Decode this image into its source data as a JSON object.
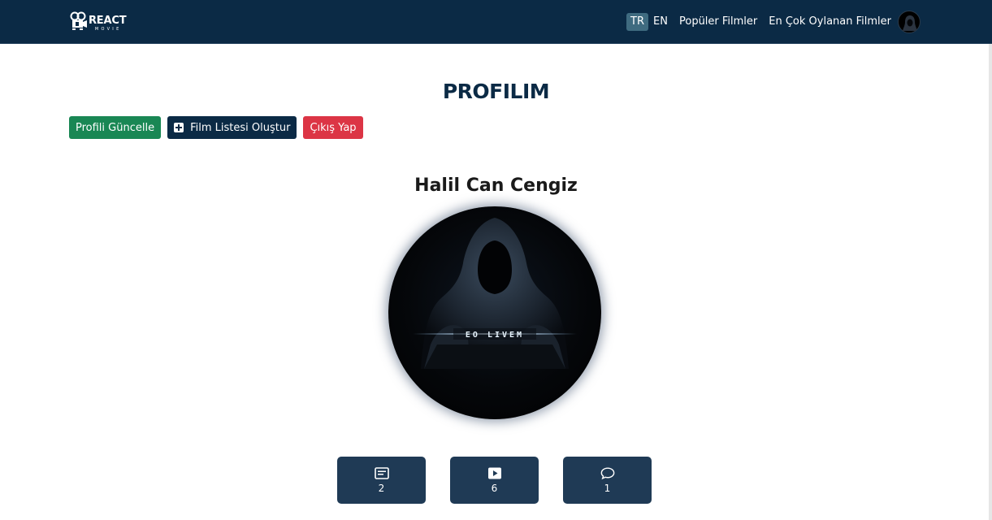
{
  "navbar": {
    "brand_title": "REACT",
    "brand_subtitle": "MOVIE",
    "languages": [
      {
        "code": "TR",
        "active": true
      },
      {
        "code": "EN",
        "active": false
      }
    ],
    "links": [
      "Popüler Filmler",
      "En Çok Oylanan Filmler"
    ]
  },
  "page": {
    "title": "PROFILIM"
  },
  "actions": {
    "update_label": "Profili Güncelle",
    "create_list_label": "Film Listesi Oluştur",
    "logout_label": "Çıkış Yap"
  },
  "profile": {
    "name": "Halil Can Cengiz",
    "avatar_caption": "EO LIVEM"
  },
  "stats": [
    {
      "icon": "list-icon",
      "value": "2"
    },
    {
      "icon": "play-icon",
      "value": "6"
    },
    {
      "icon": "comment-icon",
      "value": "1"
    }
  ],
  "colors": {
    "navbar_bg": "#0b2a45",
    "success": "#198754",
    "danger": "#dc3545",
    "stat_bg": "#1f3a55",
    "lang_active": "#3f6b80"
  }
}
